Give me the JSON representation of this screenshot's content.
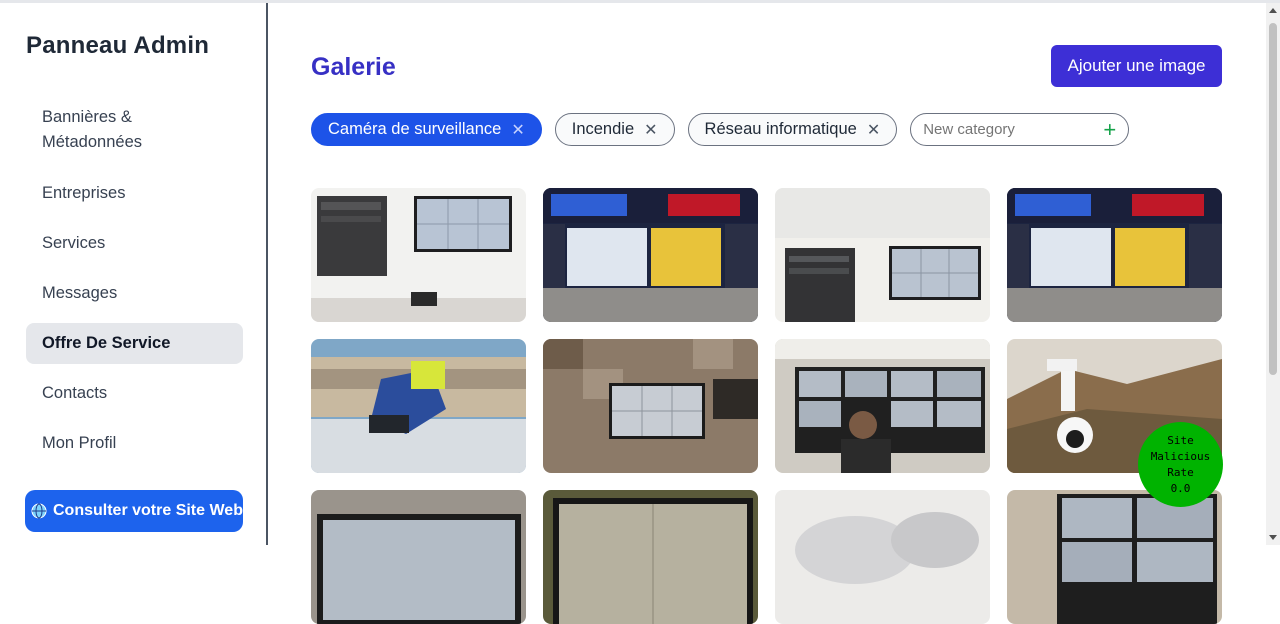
{
  "sidebar": {
    "title": "Panneau Admin",
    "items": [
      {
        "label_line1": "Bannières &",
        "label_line2": "Métadonnées"
      },
      {
        "label": "Entreprises"
      },
      {
        "label": "Services"
      },
      {
        "label": "Messages"
      },
      {
        "label": "Offre De Service",
        "active": true
      },
      {
        "label": "Contacts"
      },
      {
        "label": "Mon Profil"
      }
    ],
    "site_button": "Consulter votre Site Web"
  },
  "main": {
    "title": "Galerie",
    "add_button": "Ajouter une image",
    "categories": [
      {
        "label": "Caméra de surveillance",
        "active": true
      },
      {
        "label": "Incendie"
      },
      {
        "label": "Réseau informatique"
      }
    ],
    "new_category_placeholder": "New category"
  },
  "badge": {
    "line1": "Site",
    "line2": "Malicious",
    "line3": "Rate",
    "line4": "0.0"
  },
  "colors": {
    "accent": "#3d2fd6",
    "chip_active": "#1d53e8",
    "title": "#3730c4",
    "badge": "#00b300"
  }
}
